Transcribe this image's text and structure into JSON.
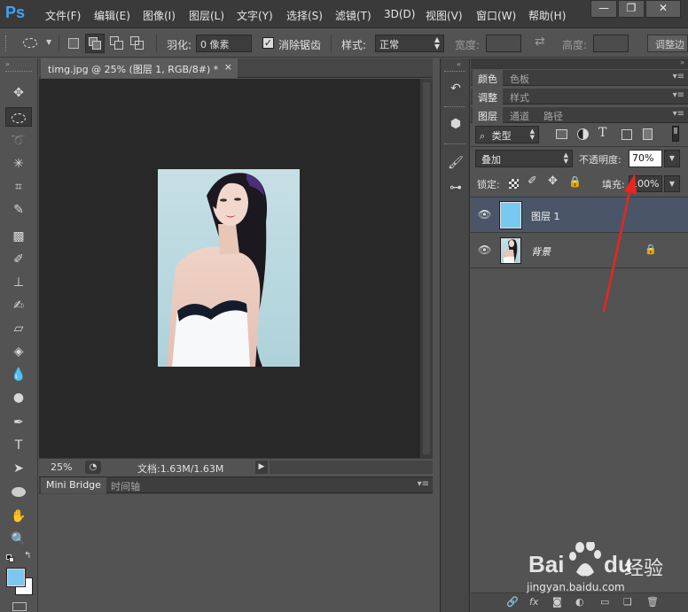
{
  "app": {
    "logo": "Ps"
  },
  "menu": [
    "文件(F)",
    "编辑(E)",
    "图像(I)",
    "图层(L)",
    "文字(Y)",
    "选择(S)",
    "滤镜(T)",
    "3D(D)",
    "视图(V)",
    "窗口(W)",
    "帮助(H)"
  ],
  "window_buttons": {
    "minimize": "—",
    "restore": "❐",
    "close": "✕"
  },
  "options": {
    "feather_label": "羽化:",
    "feather_value": "0 像素",
    "antialias_label": "消除锯齿",
    "style_label": "样式:",
    "style_value": "正常",
    "width_label": "宽度:",
    "height_label": "高度:",
    "adjust_edge": "调整边"
  },
  "document": {
    "tab_title": "timg.jpg @ 25% (图层 1, RGB/8#) *",
    "tab_close": "×",
    "zoom": "25%",
    "doc_size": "文档:1.63M/1.63M"
  },
  "bottom_panel": {
    "tabs": [
      "Mini Bridge",
      "时间轴"
    ]
  },
  "panels": {
    "group1": [
      "颜色",
      "色板"
    ],
    "group2": [
      "调整",
      "样式"
    ],
    "layers_tabs": [
      "图层",
      "通道",
      "路径"
    ]
  },
  "layers": {
    "filter_kind": "类型",
    "blend_mode": "叠加",
    "opacity_label": "不透明度:",
    "opacity_value": "70%",
    "lock_label": "锁定:",
    "fill_label": "填充:",
    "fill_value": "100%",
    "items": [
      {
        "name": "图层 1",
        "selected": true,
        "thumb_color": "#78c9f2"
      },
      {
        "name": "背景",
        "selected": false,
        "locked": true
      }
    ]
  },
  "colors": {
    "foreground": "#7cc6f0",
    "background": "#ffffff",
    "annotation_arrow": "#e8261f",
    "selected_layer_bg": "#4a5668"
  },
  "watermark": {
    "brand": "Bai",
    "brand_suffix": "du",
    "text": "经验",
    "url": "jingyan.baidu.com"
  }
}
